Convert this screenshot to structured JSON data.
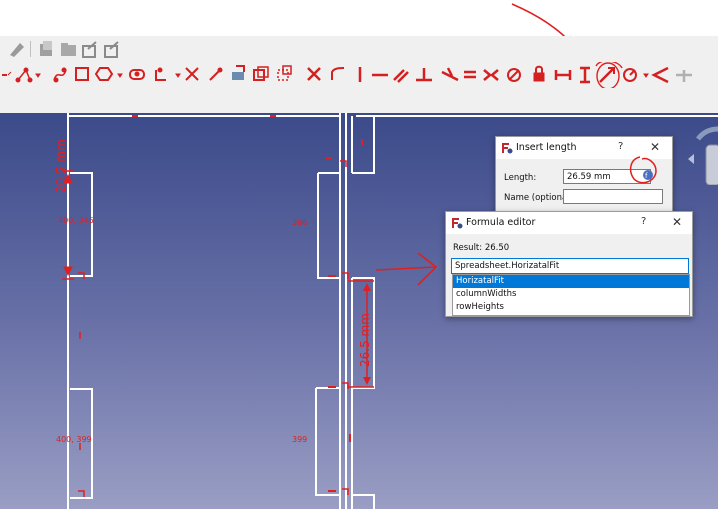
{
  "toolbar": {
    "row1_icons": [
      "measure-icon",
      "parts-icon",
      "folder-icon",
      "share-icon",
      "share-menu-icon"
    ],
    "row2_icons": [
      "polyline-icon",
      "bspline-icon",
      "rectangle-icon",
      "polygon-icon",
      "slot-icon",
      "fillet-icon",
      "trim-icon",
      "extend-icon",
      "external-geometry-icon",
      "carbon-copy-icon",
      "construction-mode-icon",
      "point-coincident-icon",
      "point-on-object-icon",
      "vertical-icon",
      "horizontal-icon",
      "parallel-icon",
      "perpendicular-icon",
      "tangent-icon",
      "equal-icon",
      "symmetric-icon",
      "block-icon",
      "lock-icon",
      "horizontal-distance-icon",
      "vertical-distance-icon",
      "distance-icon",
      "radius-icon",
      "angle-icon",
      "toggle-constraint-icon"
    ]
  },
  "insert_length_dialog": {
    "title": "Insert length",
    "help": "?",
    "close": "✕",
    "length_label": "Length:",
    "length_value": "26.59 mm",
    "name_label": "Name (optional)",
    "name_value": ""
  },
  "formula_editor": {
    "title": "Formula editor",
    "help": "?",
    "close": "✕",
    "result_label": "Result: 26.50",
    "expression_value": "Spreadsheet.HorizatalFit",
    "suggestions": [
      "HorizatalFit",
      "columnWidths",
      "rowHeights"
    ],
    "selected_suggestion": "HorizatalFit"
  },
  "sketch": {
    "dimension_left": "20.5 mm",
    "dimension_right": "26.5 mm",
    "label_400_346": "400, 346",
    "label_396": "396",
    "label_400_399": "400, 399",
    "label_399": "399"
  },
  "colors": {
    "constraint": "#e02020",
    "geometry": "#ffffff",
    "selection": "#0078d7"
  }
}
